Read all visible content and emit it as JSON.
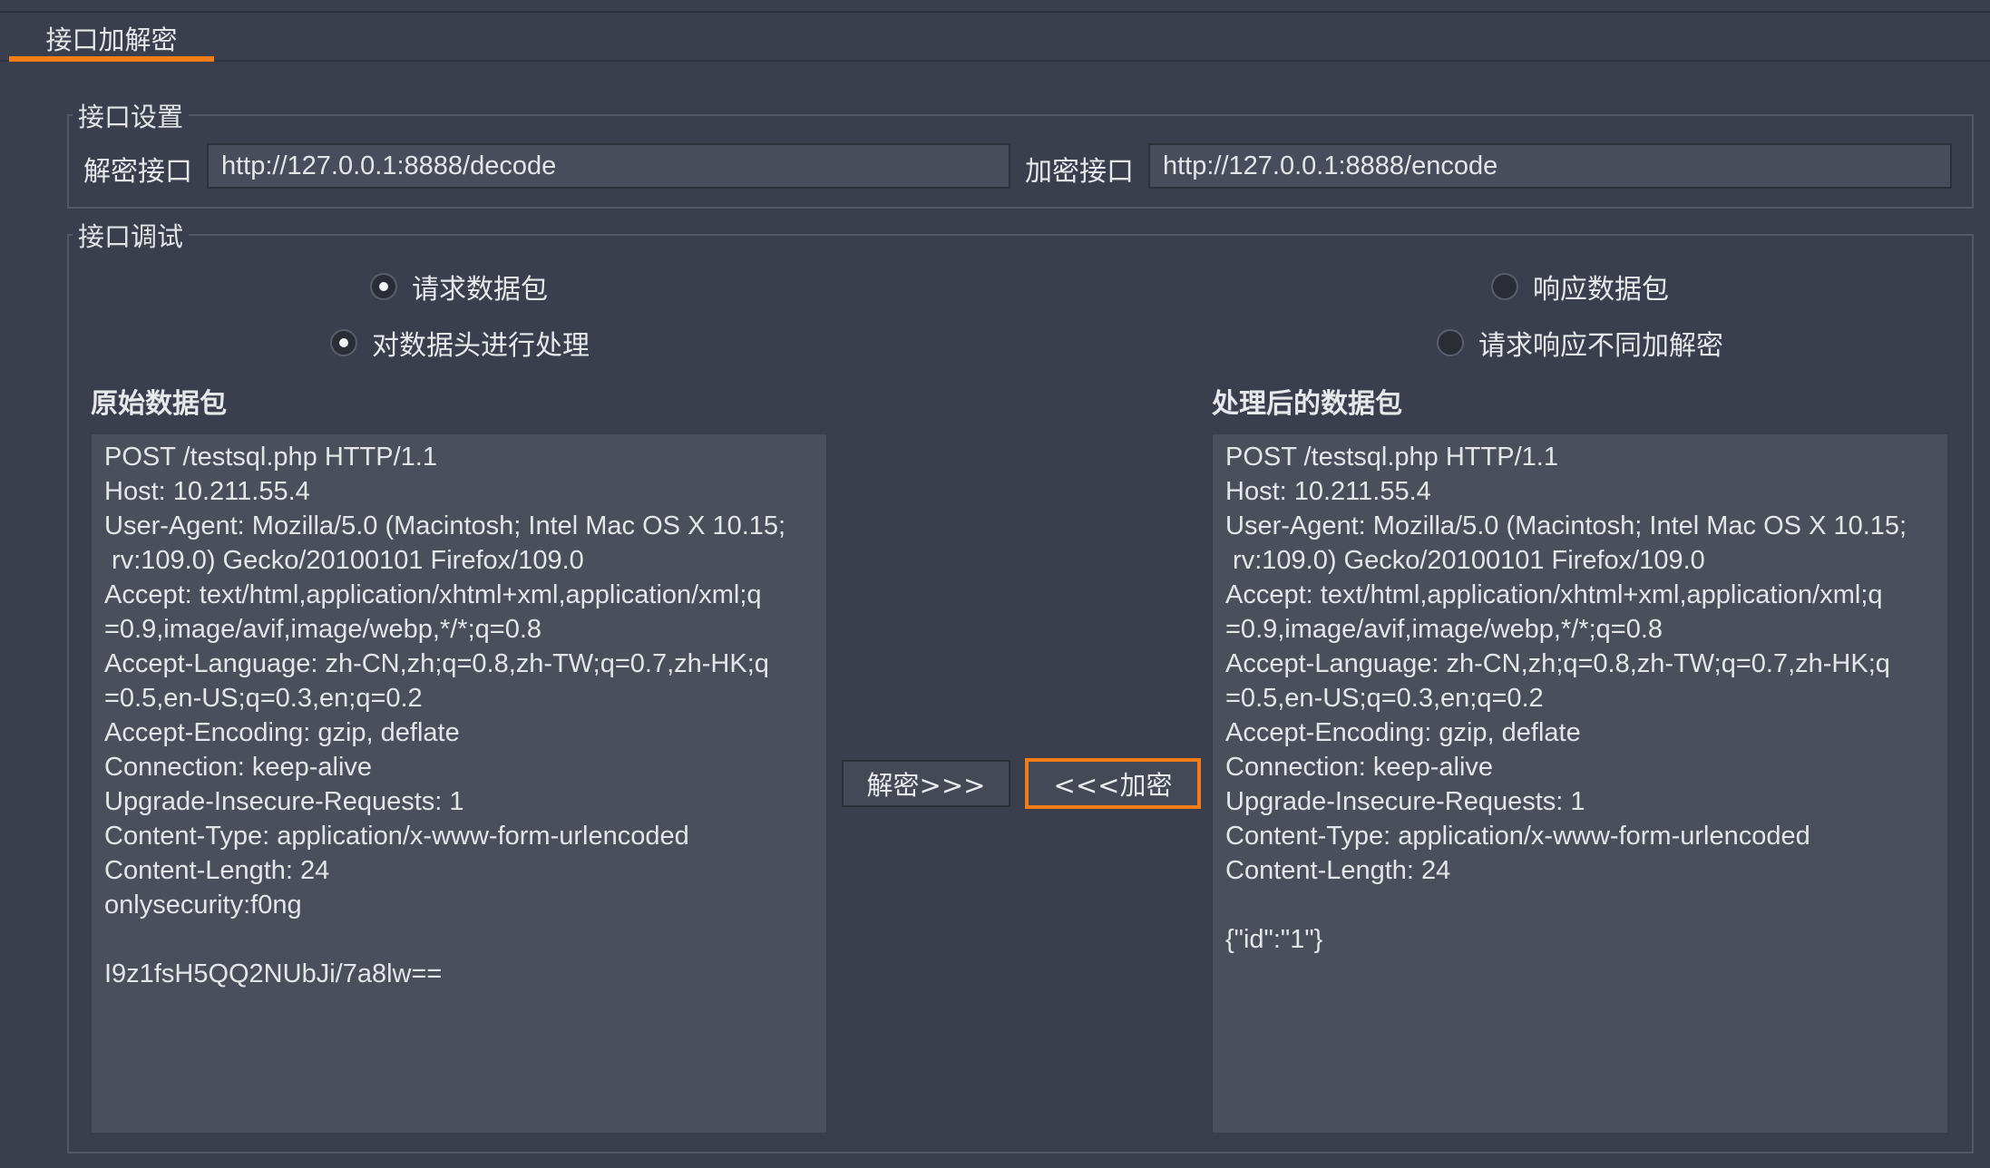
{
  "tabs": [
    {
      "label": "接口加解密",
      "active": true
    }
  ],
  "settings": {
    "legend": "接口设置",
    "decode_label": "解密接口",
    "decode_url": "http://127.0.0.1:8888/decode",
    "encode_label": "加密接口",
    "encode_url": "http://127.0.0.1:8888/encode"
  },
  "debug": {
    "legend": "接口调试",
    "radio_request": {
      "label": "请求数据包",
      "checked": true
    },
    "radio_response": {
      "label": "响应数据包",
      "checked": false
    },
    "radio_header": {
      "label": "对数据头进行处理",
      "checked": true
    },
    "radio_diff": {
      "label": "请求响应不同加解密",
      "checked": false
    },
    "original_title": "原始数据包",
    "processed_title": "处理后的数据包",
    "decrypt_button": "解密>>>",
    "encrypt_button": "<<<加密",
    "original_lines": [
      "POST /testsql.php HTTP/1.1",
      "Host: 10.211.55.4",
      "User-Agent: Mozilla/5.0 (Macintosh; Intel Mac OS X 10.15;",
      " rv:109.0) Gecko/20100101 Firefox/109.0",
      "Accept: text/html,application/xhtml+xml,application/xml;q",
      "=0.9,image/avif,image/webp,*/*;q=0.8",
      "Accept-Language: zh-CN,zh;q=0.8,zh-TW;q=0.7,zh-HK;q",
      "=0.5,en-US;q=0.3,en;q=0.2",
      "Accept-Encoding: gzip, deflate",
      "Connection: keep-alive",
      "Upgrade-Insecure-Requests: 1",
      "Content-Type: application/x-www-form-urlencoded",
      "Content-Length: 24",
      "onlysecurity:f0ng",
      "",
      "I9z1fsH5QQ2NUbJi/7a8lw=="
    ],
    "processed_lines": [
      "POST /testsql.php HTTP/1.1",
      "Host: 10.211.55.4",
      "User-Agent: Mozilla/5.0 (Macintosh; Intel Mac OS X 10.15;",
      " rv:109.0) Gecko/20100101 Firefox/109.0",
      "Accept: text/html,application/xhtml+xml,application/xml;q",
      "=0.9,image/avif,image/webp,*/*;q=0.8",
      "Accept-Language: zh-CN,zh;q=0.8,zh-TW;q=0.7,zh-HK;q",
      "=0.5,en-US;q=0.3,en;q=0.2",
      "Accept-Encoding: gzip, deflate",
      "Connection: keep-alive",
      "Upgrade-Insecure-Requests: 1",
      "Content-Type: application/x-www-form-urlencoded",
      "Content-Length: 24",
      "",
      "{\"id\":\"1\"}"
    ]
  },
  "colors": {
    "accent": "#f07d15",
    "background": "#3b3f4d",
    "panel": "#4b4f5c"
  }
}
